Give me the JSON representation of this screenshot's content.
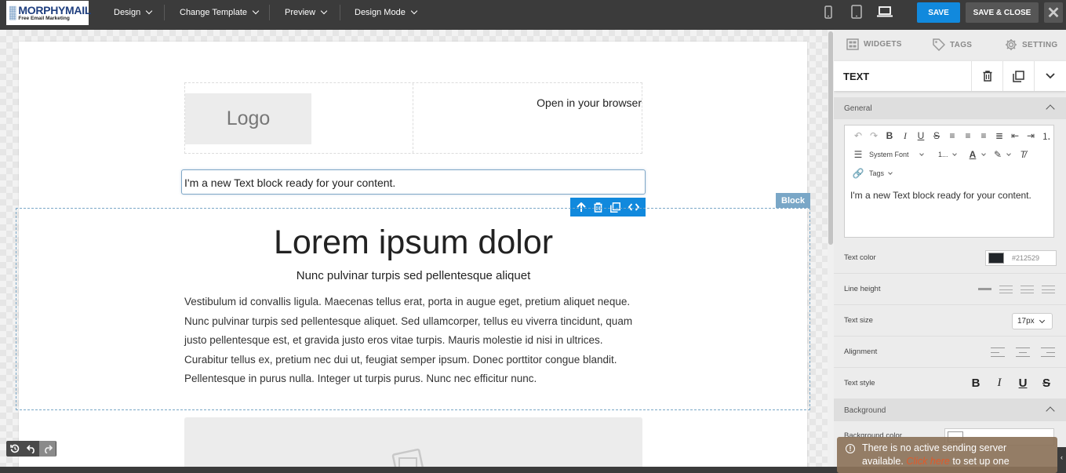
{
  "app": {
    "logo_main": "MORPHYMAIL",
    "logo_sub": "Free Email Marketing"
  },
  "menu": {
    "design": "Design",
    "change_template": "Change Template",
    "preview": "Preview",
    "design_mode": "Design Mode"
  },
  "devices": [
    "mobile-icon",
    "tablet-icon",
    "desktop-icon"
  ],
  "actions": {
    "save": "SAVE",
    "save_close": "SAVE & CLOSE",
    "close": "✕"
  },
  "canvas": {
    "logo_placeholder": "Logo",
    "open_browser": "Open in your browser",
    "text_block": "I'm a new Text block ready for your content.",
    "block_tag": "Block",
    "hero_title": "Lorem ipsum dolor",
    "hero_subtitle": "Nunc pulvinar turpis sed pellentesque aliquet",
    "hero_body": [
      "Vestibulum id convallis ligula. Maecenas tellus erat, porta in augue eget, pretium aliquet neque.",
      "Nunc pulvinar turpis sed pellentesque aliquet. Sed ullamcorper, tellus eu viverra tincidunt, quam",
      "justo pellentesque est, et gravida justo eros vitae turpis. Mauris molestie id nisi in ultrices.",
      "Curabitur tellus ex, pretium nec dui ut, feugiat semper ipsum. Donec porttitor congue blandit.",
      "Pellentesque in purus nulla. Integer ut turpis purus. Nunc nec efficitur nunc."
    ]
  },
  "panel": {
    "tabs": {
      "widgets": "WIDGETS",
      "tags": "TAGS",
      "setting": "SETTING"
    },
    "title": "TEXT",
    "general": "General",
    "editor": {
      "font": "System Font",
      "size": "1...",
      "tags": "Tags",
      "content": "I'm a new Text block ready for your content."
    },
    "text_color_label": "Text color",
    "text_color_value": "#212529",
    "line_height_label": "Line height",
    "text_size_label": "Text size",
    "text_size_value": "17px",
    "alignment_label": "Alignment",
    "text_style_label": "Text style",
    "text_style": {
      "bold": "B",
      "italic": "I",
      "underline": "U",
      "strike": "S"
    },
    "background": "Background",
    "background_color_label": "Background color"
  },
  "toast": {
    "line1": "There is no active sending server",
    "line2_pre": "available.",
    "link": "Click here",
    "line2_post": "to set up one"
  },
  "colors": {
    "accent": "#1189dd",
    "topbar": "#3b3b3b",
    "text_color_swatch": "#212529"
  }
}
